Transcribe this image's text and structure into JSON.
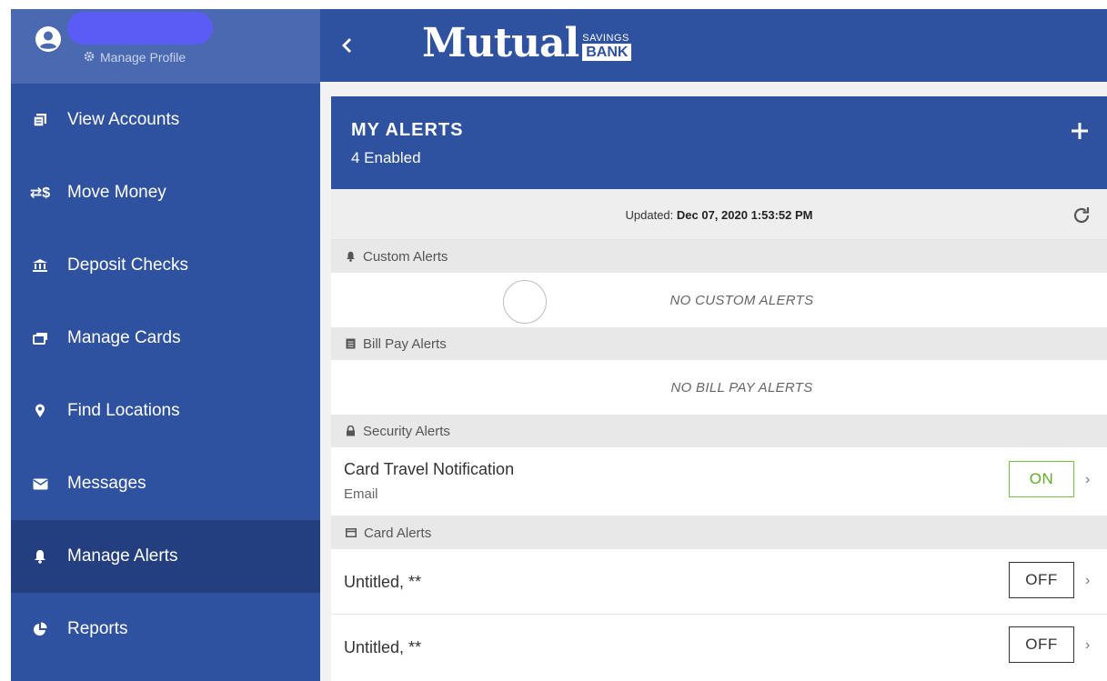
{
  "colors": {
    "brand": "#2f52a0",
    "active_nav": "#233f80",
    "on_green": "#7ac143"
  },
  "profile": {
    "manage_label": "Manage Profile"
  },
  "sidebar": {
    "items": [
      {
        "label": "View Accounts",
        "icon": "accounts-icon"
      },
      {
        "label": "Move Money",
        "icon": "transfer-icon"
      },
      {
        "label": "Deposit Checks",
        "icon": "bank-icon"
      },
      {
        "label": "Manage Cards",
        "icon": "cards-icon"
      },
      {
        "label": "Find Locations",
        "icon": "location-pin-icon"
      },
      {
        "label": "Messages",
        "icon": "envelope-icon"
      },
      {
        "label": "Manage Alerts",
        "icon": "bell-icon",
        "active": true
      },
      {
        "label": "Reports",
        "icon": "pie-chart-icon"
      }
    ]
  },
  "header": {
    "logo_word": "Mutual",
    "logo_savings": "SAVINGS",
    "logo_bank": "BANK"
  },
  "alerts": {
    "title": "MY ALERTS",
    "count": "4 Enabled",
    "updated_label": "Updated:",
    "updated_value": "Dec 07, 2020 1:53:52 PM",
    "sections": {
      "custom": {
        "title": "Custom Alerts",
        "empty": "NO CUSTOM ALERTS"
      },
      "billpay": {
        "title": "Bill Pay Alerts",
        "empty": "NO BILL PAY ALERTS"
      },
      "security": {
        "title": "Security Alerts"
      },
      "card": {
        "title": "Card Alerts"
      }
    },
    "security_items": [
      {
        "name": "Card Travel Notification",
        "sub": "Email",
        "state": "ON"
      }
    ],
    "card_items": [
      {
        "name": "Untitled, **",
        "state": "OFF"
      },
      {
        "name": "Untitled, **",
        "state": "OFF"
      }
    ]
  }
}
